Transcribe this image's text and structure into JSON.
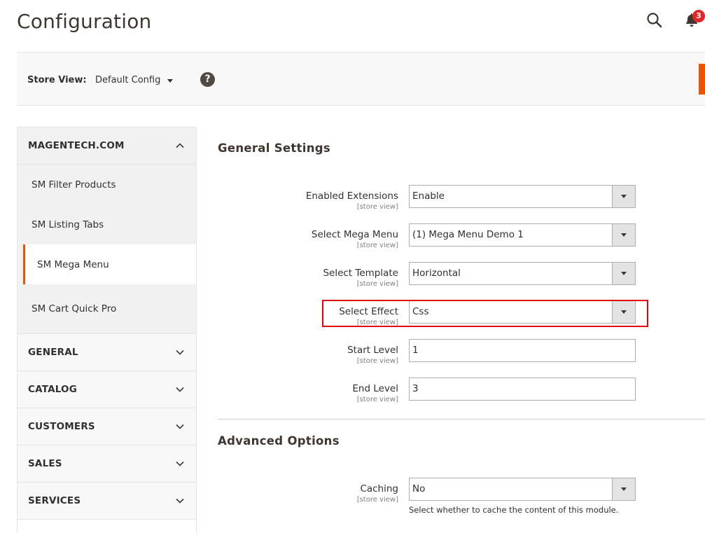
{
  "header": {
    "title": "Configuration",
    "search_icon": "search-icon",
    "bell_icon": "bell-icon",
    "notification_count": "3"
  },
  "store_view": {
    "label": "Store View:",
    "value": "Default Config",
    "help_glyph": "?"
  },
  "sidebar": {
    "expanded_group": {
      "title": "MAGENTECH.COM",
      "items": [
        {
          "label": "SM Filter Products"
        },
        {
          "label": "SM Listing Tabs"
        },
        {
          "label": "SM Mega Menu"
        },
        {
          "label": "SM Cart Quick Pro"
        }
      ]
    },
    "groups": [
      {
        "title": "GENERAL"
      },
      {
        "title": "CATALOG"
      },
      {
        "title": "CUSTOMERS"
      },
      {
        "title": "SALES"
      },
      {
        "title": "SERVICES"
      }
    ]
  },
  "general_settings": {
    "title": "General Settings",
    "fields": [
      {
        "label": "Enabled Extensions",
        "scope": "[store view]",
        "value": "Enable"
      },
      {
        "label": "Select Mega Menu",
        "scope": "[store view]",
        "value": "(1) Mega Menu Demo 1"
      },
      {
        "label": "Select Template",
        "scope": "[store view]",
        "value": "Horizontal"
      },
      {
        "label": "Select Effect",
        "scope": "[store view]",
        "value": "Css"
      },
      {
        "label": "Start Level",
        "scope": "[store view]",
        "value": "1"
      },
      {
        "label": "End Level",
        "scope": "[store view]",
        "value": "3"
      }
    ]
  },
  "advanced_options": {
    "title": "Advanced Options",
    "caching": {
      "label": "Caching",
      "scope": "[store view]",
      "value": "No",
      "hint": "Select whether to cache the content of this module."
    }
  },
  "colors": {
    "accent": "#eb5202",
    "highlight": "#e0000f",
    "badge": "#e22626"
  }
}
